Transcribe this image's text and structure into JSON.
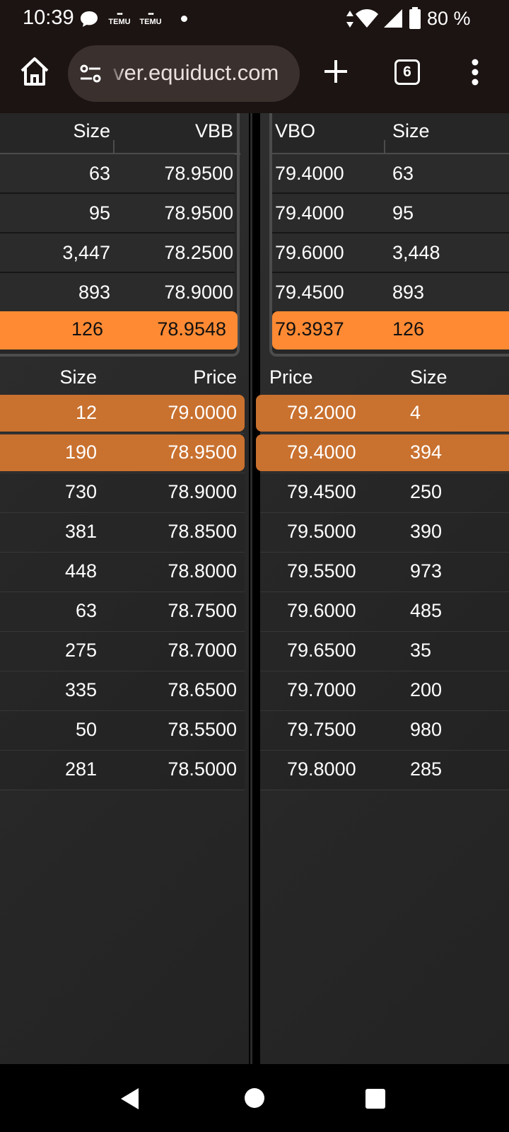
{
  "status_bar": {
    "time": "10:39",
    "notif_app_1": "TEMU",
    "notif_app_2": "TEMU",
    "battery_percent": "80 %"
  },
  "browser": {
    "url": "ver.equiduct.com",
    "tab_count": "6"
  },
  "bbo_bid": {
    "headers": {
      "size": "Size",
      "price": "VBB"
    },
    "rows": [
      {
        "size": "63",
        "price": "78.9500"
      },
      {
        "size": "95",
        "price": "78.9500"
      },
      {
        "size": "3,447",
        "price": "78.2500"
      },
      {
        "size": "893",
        "price": "78.9000"
      }
    ],
    "highlight": {
      "size": "126",
      "price": "78.9548"
    }
  },
  "bbo_offer": {
    "headers": {
      "price": "VBO",
      "size": "Size"
    },
    "rows": [
      {
        "price": "79.4000",
        "size": "63"
      },
      {
        "price": "79.4000",
        "size": "95"
      },
      {
        "price": "79.6000",
        "size": "3,448"
      },
      {
        "price": "79.4500",
        "size": "893"
      }
    ],
    "highlight": {
      "price": "79.3937",
      "size": "126"
    }
  },
  "book_bid": {
    "headers": {
      "size": "Size",
      "price": "Price"
    },
    "rows": [
      {
        "size": "12",
        "price": "79.0000",
        "highlighted": true
      },
      {
        "size": "190",
        "price": "78.9500",
        "highlighted": true
      },
      {
        "size": "730",
        "price": "78.9000"
      },
      {
        "size": "381",
        "price": "78.8500"
      },
      {
        "size": "448",
        "price": "78.8000"
      },
      {
        "size": "63",
        "price": "78.7500"
      },
      {
        "size": "275",
        "price": "78.7000"
      },
      {
        "size": "335",
        "price": "78.6500"
      },
      {
        "size": "50",
        "price": "78.5500"
      },
      {
        "size": "281",
        "price": "78.5000"
      }
    ]
  },
  "book_ask": {
    "headers": {
      "price": "Price",
      "size": "Size"
    },
    "rows": [
      {
        "price": "79.2000",
        "size": "4",
        "highlighted": true
      },
      {
        "price": "79.4000",
        "size": "394",
        "highlighted": true
      },
      {
        "price": "79.4500",
        "size": "250"
      },
      {
        "price": "79.5000",
        "size": "390"
      },
      {
        "price": "79.5500",
        "size": "973"
      },
      {
        "price": "79.6000",
        "size": "485"
      },
      {
        "price": "79.6500",
        "size": "35"
      },
      {
        "price": "79.7000",
        "size": "200"
      },
      {
        "price": "79.7500",
        "size": "980"
      },
      {
        "price": "79.8000",
        "size": "285"
      }
    ]
  },
  "colors": {
    "highlight_bbo": "#ff8a33",
    "highlight_book": "#c9712f",
    "panel_bg": "#2a2a2a"
  },
  "icons": [
    "home-icon",
    "site-settings-icon",
    "plus-icon",
    "tab-switcher-icon",
    "more-vert-icon",
    "back-icon",
    "home-circle-icon",
    "recents-icon"
  ]
}
